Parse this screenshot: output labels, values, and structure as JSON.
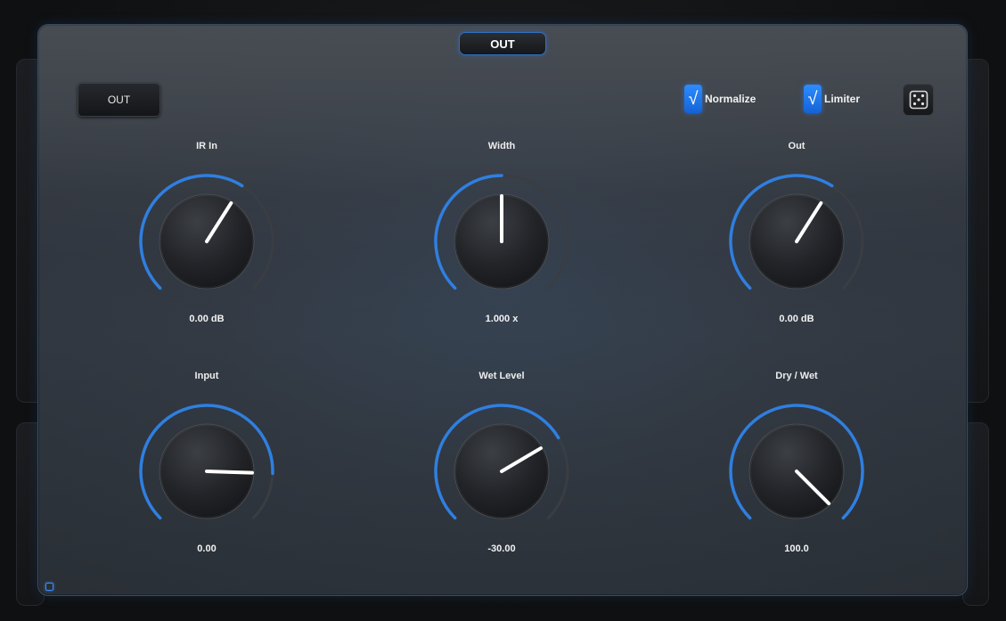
{
  "header": {
    "title": "OUT"
  },
  "toolbar": {
    "out_button_label": "OUT",
    "normalize": {
      "label": "Normalize",
      "checked": true
    },
    "limiter": {
      "label": "Limiter",
      "checked": true
    },
    "randomize_icon": "dice-icon"
  },
  "knobs": [
    {
      "id": "ir-in",
      "label": "IR In",
      "value": "0.00 dB",
      "fill": 0.62
    },
    {
      "id": "width",
      "label": "Width",
      "value": "1.000 x",
      "fill": 0.5
    },
    {
      "id": "out",
      "label": "Out",
      "value": "0.00 dB",
      "fill": 0.62
    },
    {
      "id": "input",
      "label": "Input",
      "value": "0.00",
      "fill": 0.84
    },
    {
      "id": "wet-level",
      "label": "Wet Level",
      "value": "-30.00",
      "fill": 0.72
    },
    {
      "id": "dry-wet",
      "label": "Dry / Wet",
      "value": "100.0",
      "fill": 1.0
    }
  ],
  "colors": {
    "accent": "#2f7fe0",
    "track": "#3a3d42",
    "pointer": "#ffffff"
  }
}
